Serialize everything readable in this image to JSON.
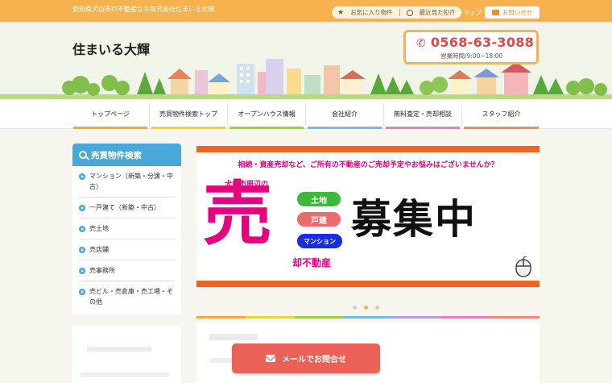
{
  "topbar": {
    "tagline": "愛知県犬山市の不動産なら株式会社住まいる大輝",
    "favorites_label": "お気に入り物件",
    "recent_label": "最近見た物件",
    "sitemap_label": "サイトマップ",
    "contact_label": "お問い合せ"
  },
  "header": {
    "logo": "住まいる大輝",
    "phone": "0568-63-3088",
    "hours": "営業時間/9:00~18:00"
  },
  "nav": {
    "items": [
      {
        "label": "トップページ",
        "color": "#f3a64a"
      },
      {
        "label": "売買物件検索トップ",
        "color": "#e8d33a"
      },
      {
        "label": "オープンハウス情報",
        "color": "#9fcf4a"
      },
      {
        "label": "会社紹介",
        "color": "#7ab8e6"
      },
      {
        "label": "無料査定・売却相談",
        "color": "#e57fb8"
      },
      {
        "label": "スタッフ紹介",
        "color": "#ee8877"
      }
    ]
  },
  "sidebar": {
    "title": "売買物件検索",
    "items": [
      {
        "label": "マンション（新築・分譲・中古）"
      },
      {
        "label": "一戸建て（新築・中古）"
      },
      {
        "label": "売土地"
      },
      {
        "label": "売店舗"
      },
      {
        "label": "売事務所"
      },
      {
        "label": "売ビル・売倉庫・売工場・その他"
      }
    ]
  },
  "banner": {
    "question": "相続・資産売却など、ご所有の不動産のご売却予定やお悩みはございませんか？",
    "area": "犬山市周辺の",
    "big_char": "売",
    "pill_land": "土地",
    "pill_house": "戸建",
    "pill_mansion": "マンション",
    "subtitle": "却不動産",
    "recruit": "募集中"
  },
  "slider": {
    "active_index": 1,
    "count": 3
  },
  "rainbow_colors": [
    "#f3a64a",
    "#e8d33a",
    "#9fcf4a",
    "#7ab8e6",
    "#b59be0",
    "#e57fb8",
    "#ee8877"
  ],
  "mail_button": {
    "label": "メールでお問合せ"
  },
  "theme": {
    "accent": "#f5b24e",
    "sidebar_blue": "#4aa8d8",
    "banner_pink": "#e4007f",
    "banner_orange": "#ee6420",
    "mail_red": "#ea6157"
  }
}
